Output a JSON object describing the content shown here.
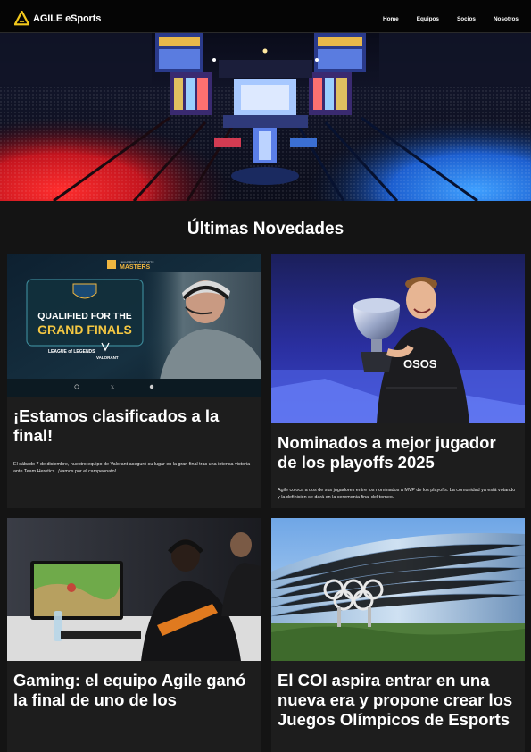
{
  "navbar": {
    "brand": "AGILE eSports",
    "links": [
      "Home",
      "Equipos",
      "Socios",
      "Nosotros"
    ]
  },
  "hero": {
    "image": "esports-arena-photo"
  },
  "section": {
    "title": "Últimas Novedades"
  },
  "cards": [
    {
      "image": "qualified-grand-finals-banner",
      "banner_badge": "UNIVERSITY ESPORTS",
      "banner_event": "MASTERS",
      "banner_line1": "QUALIFIED FOR THE",
      "banner_line2": "GRAND FINALS",
      "banner_game1": "LEAGUE of LEGENDS",
      "banner_game2": "VALORANT",
      "title": "¡Estamos clasificados a la final!",
      "text": "El sábado 7 de diciembre, nuestro equipo de Valorant aseguró su lugar en la gran final tras una intensa victoria ante Team Heretics. ¡Vamos por el campeonato!"
    },
    {
      "image": "player-with-trophy-photo",
      "title": "Nominados a mejor jugador de los playoffs 2025",
      "text": "Agile coloca a dos de sus jugadores entre los nominados a MVP de los playoffs. La comunidad ya está votando y la definición se dará en la ceremonia final del torneo."
    },
    {
      "image": "gamers-competing-photo",
      "title": "Gaming: el equipo Agile ganó la final de uno de los",
      "text": ""
    },
    {
      "image": "olympic-rings-building-photo",
      "title": "El COI aspira entrar en una nueva era y propone crear los Juegos Olímpicos de Esports",
      "text": ""
    }
  ],
  "colors": {
    "background": "#141414",
    "card": "#1d1d1d",
    "navbar": "#050505",
    "brand_yellow": "#f2c81c"
  }
}
